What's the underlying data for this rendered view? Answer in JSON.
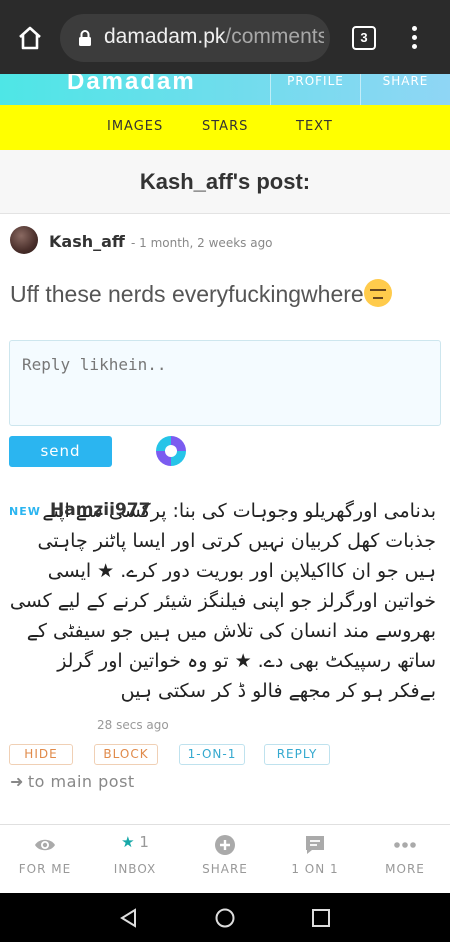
{
  "browser": {
    "domain": "damadam.pk",
    "path": "/comments",
    "tab_count": "3"
  },
  "site": {
    "logo": "Damadam",
    "header_nav": [
      "PROFILE",
      "SHARE"
    ],
    "sub_nav": [
      "IMAGES",
      "STARS",
      "TEXT"
    ]
  },
  "post": {
    "title": "Kash_aff's post:",
    "author": "Kash_aff",
    "time": "- 1 month, 2 weeks ago",
    "body": "Uff these nerds everyfuckingwhere"
  },
  "reply": {
    "placeholder": "Reply likhein..",
    "send_label": "send"
  },
  "comment": {
    "badge": "NEW",
    "author": "Hamzii977",
    "text": "بدنامی اورگھریلو وجوہات کی بنا: پرکسی سے اپنے جذبات کھل کربیان نہیں کرتی اور ایسا پاٹنر چاہتی ہیں جو ان کااکیلاپن اور بوریت دور کرے. ★ ایسی خواتین اورگرلز جو اپنی فیلنگز شیئر کرنے کے لیے کسی بھروسے مند انسان کی تلاش میں ہیں جو سیفٹی کے ساتھ رسپیکٹ بھی دے. ★ تو وہ خواتین اور گرلز بےفکر ہو کر مجھے فالو ڈ کر سکتی ہیں",
    "time": "28 secs ago",
    "actions": [
      "HIDE",
      "BLOCK",
      "1-ON-1",
      "REPLY"
    ]
  },
  "back_link": "to main post",
  "bottom_nav": [
    {
      "label": "FOR ME",
      "icon": "eye-icon"
    },
    {
      "label": "INBOX",
      "icon": "star-icon",
      "count": "1"
    },
    {
      "label": "SHARE",
      "icon": "plus-circle-icon"
    },
    {
      "label": "1 ON 1",
      "icon": "chat-bubble-icon"
    },
    {
      "label": "MORE",
      "icon": "more-dots-icon"
    }
  ],
  "colors": {
    "header_gradient_start": "#4ee6e6",
    "yellow_bar": "#ffff00",
    "send_button": "#2bb5f0",
    "warn_action": "#e08a4a",
    "info_action": "#35a9cf"
  }
}
